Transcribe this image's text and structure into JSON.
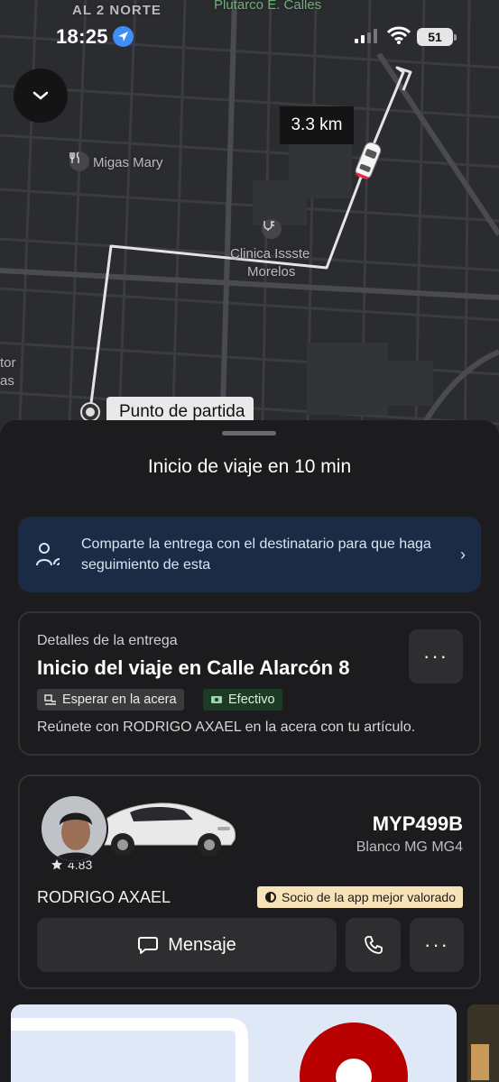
{
  "status_bar": {
    "time": "18:25",
    "battery": "51"
  },
  "map": {
    "labels": {
      "street_top": "AL 2 NORTE",
      "plutarco": "Plutarco E. Calles",
      "migas": "Migas Mary",
      "clinica_line1": "Clinica Issste",
      "clinica_line2": "Morelos",
      "left_1": "tor",
      "left_2": "as"
    },
    "distance": "3.3 km",
    "start_label": "Punto de partida"
  },
  "sheet": {
    "title": "Inicio de viaje en 10 min",
    "share": {
      "text": "Comparte la entrega con el destinatario para que haga seguimiento de esta",
      "chevron": "›"
    },
    "delivery": {
      "label": "Detalles de la entrega",
      "title": "Inicio del viaje en Calle Alarcón 8",
      "more": "···",
      "tag_wait": "Esperar en la acera",
      "tag_payment": "Efectivo",
      "note": "Reúnete con RODRIGO AXAEL en la acera con tu artículo."
    },
    "driver": {
      "rating": "4.83",
      "plate": "MYP499B",
      "car_model": "Blanco MG MG4",
      "name": "RODRIGO AXAEL",
      "badge": "Socio de la app mejor valorado",
      "message_label": "Mensaje",
      "more": "···"
    }
  },
  "colors": {
    "map_bg": "#2b2c30",
    "share_card": "#1c2b45",
    "cash_tag": "#1d3a25",
    "top_badge": "#f7e3b7"
  }
}
